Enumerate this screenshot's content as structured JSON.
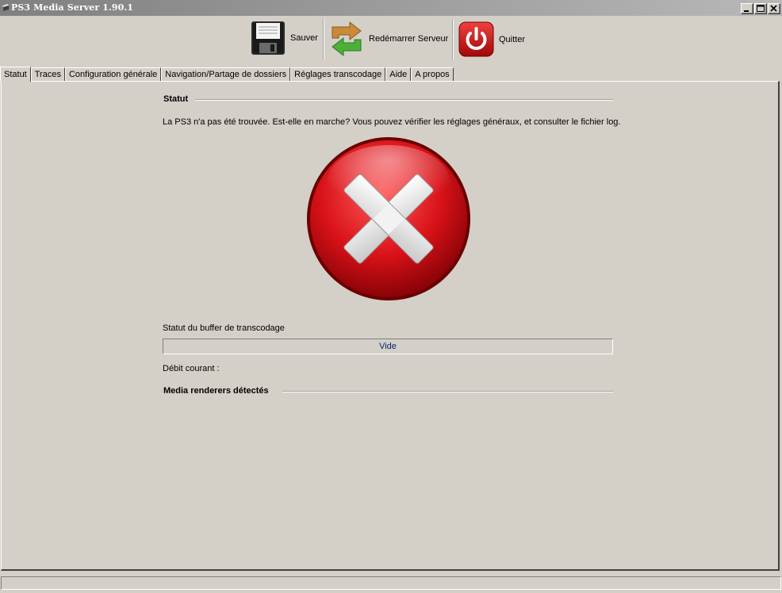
{
  "window": {
    "title": "PS3 Media Server 1.90.1"
  },
  "toolbar": {
    "save_label": "Sauver",
    "restart_label": "Redémarrer Serveur",
    "quit_label": "Quitter"
  },
  "tabs": [
    {
      "label": "Statut",
      "active": true
    },
    {
      "label": "Traces",
      "active": false
    },
    {
      "label": "Configuration générale",
      "active": false
    },
    {
      "label": "Navigation/Partage de dossiers",
      "active": false
    },
    {
      "label": "Réglages transcodage",
      "active": false
    },
    {
      "label": "Aide",
      "active": false
    },
    {
      "label": "A propos",
      "active": false
    }
  ],
  "status": {
    "section_title": "Statut",
    "message": "La PS3 n'a pas été trouvée. Est-elle en marche? Vous pouvez vérifier les réglages généraux, et consulter le fichier log.",
    "icon": "error-x-icon",
    "icon_color": "#c8101a"
  },
  "buffer": {
    "label": "Statut du buffer de transcodage",
    "value_text": "Vide",
    "progress": 0
  },
  "bitrate": {
    "label": "Débit courant :"
  },
  "renderers": {
    "section_title": "Media renderers détectés"
  },
  "colors": {
    "background": "#d4d0c8",
    "progress_text": "#0a246a"
  }
}
